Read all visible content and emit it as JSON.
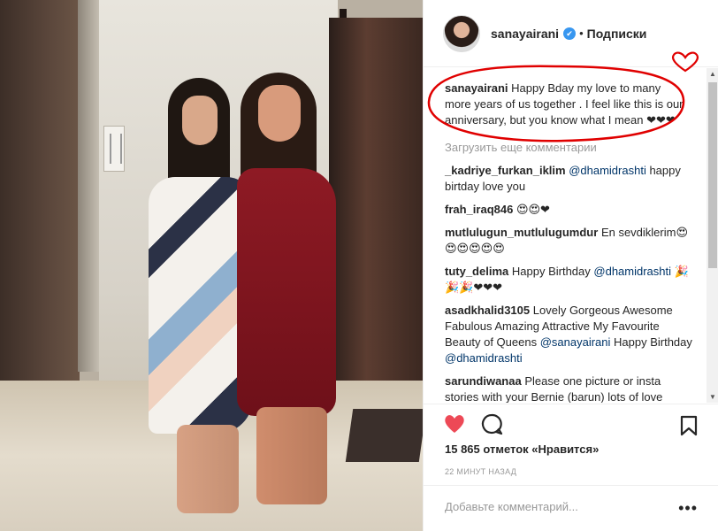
{
  "header": {
    "username": "sanayairani",
    "verified_glyph": "✔",
    "separator": "•",
    "follow_label": "Подписки"
  },
  "caption": {
    "username": "sanayairani",
    "text": "Happy Bday my love to many more years of us together . I feel like this is our anniversary, but you know what I mean ❤❤❤"
  },
  "load_more_label": "Загрузить еще комментарии",
  "comments": [
    {
      "username": "_kadriye_furkan_iklim",
      "mention": "@dhamidrashti",
      "text": "happy birtday love you"
    },
    {
      "username": "frah_iraq846",
      "text": "😍😍❤"
    },
    {
      "username": "mutlulugun_mutlulugumdur",
      "text": "En sevdiklerim😍😍😍😍😍😍"
    },
    {
      "username": "tuty_delima",
      "text": "Happy Birthday",
      "mention": "@dhamidrashti",
      "text2": "🎉🎉🎉❤❤❤"
    },
    {
      "username": "asadkhalid3105",
      "text": "Lovely Gorgeous Awesome Fabulous Amazing Attractive My Favourite Beauty of Queens",
      "mention": "@sanayairani",
      "text2": "Happy Birthday",
      "mention2": "@dhamidrashti"
    },
    {
      "username": "sarundiwanaa",
      "text": "Please one picture or insta stories with your Bernie (barun) lots of love"
    }
  ],
  "actions": {
    "like_icon": "heart-icon",
    "comment_icon": "comment-icon",
    "save_icon": "bookmark-icon"
  },
  "likes_text": "15 865 отметок «Нравится»",
  "timestamp": "22 МИНУТ НАЗАД",
  "add_comment_placeholder": "Добавьте комментарий...",
  "more_glyph": "•••",
  "colors": {
    "like_red": "#ed4956",
    "link_blue": "#003569",
    "verified_blue": "#3897f0",
    "annotation_red": "#e00000"
  }
}
